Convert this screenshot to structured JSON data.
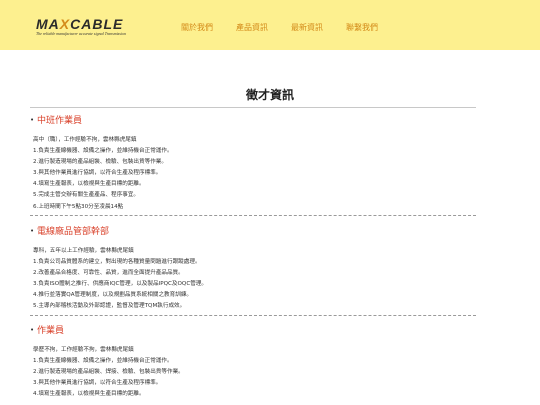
{
  "header": {
    "logo_text": "MAXCABLE",
    "logo_tagline": "The reliable manufacturer accurate signal Transmission",
    "nav": [
      "關於我們",
      "產品資訊",
      "最新資訊",
      "聯繫我們"
    ]
  },
  "page_title": "徵才資訊",
  "jobs": [
    {
      "title": "中班作業員",
      "lines": [
        "高中（職），工作經驗不拘，雲林縣虎尾鎮",
        "1.負責生產線機器、設備之操作，並維持機台正常運作。",
        "2.進行製造現場的產品組裝、檢驗、包裝出貨等作業。",
        "3.與其他作業員進行協調，以符合生產及程序標準。",
        "4.填寫生產報表，以檢視與生產目標的距離。",
        "5.完成主管交辦有關生產產品、程序事宜。",
        "6.上班時間下午5點30分至凌晨14點"
      ]
    },
    {
      "title": "電線廠品管部幹部",
      "lines": [
        "專科，五年以上工作經驗，雲林縣虎尾鎮",
        "1.負責公司品質體系的建立，對出現的各種質量問題進行跟蹤處理。",
        "2.改善產品合格度、可靠性、品質，進而全面提升產品品質。",
        "3.負責ISO體制之推行、供應商IQC管理，以及製品IPQC及OQC管理。",
        "4.推行並落實QA管理制度，以及規劃品質系統相關之教育訓練。",
        "5.主導內部稽核活動及外部認證，監督及管理TQM執行成效。"
      ]
    },
    {
      "title": "作業員",
      "lines": [
        "學歷不拘，工作經驗不拘，雲林縣虎尾鎮",
        "1.負責生產線機器、設備之操作，並維持機台正常運作。",
        "2.進行製造現場的產品組裝、焊接、檢驗、包裝出貨等作業。",
        "3.與其他作業員進行協調，以符合生產及程序標準。",
        "4.填寫生產報表，以檢視與生產目標的距離。"
      ]
    }
  ],
  "colors": {
    "header_bg": "#fdf08f",
    "nav_text": "#d48b1a",
    "job_title": "#d9412a"
  }
}
